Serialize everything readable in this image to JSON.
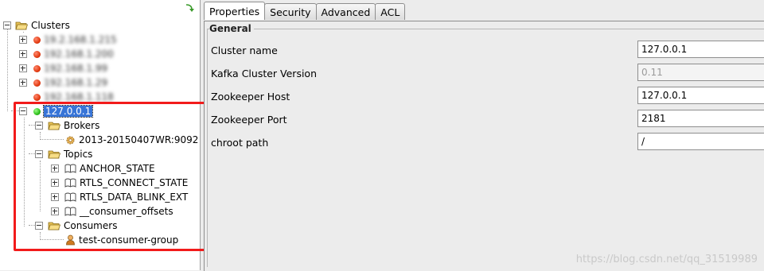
{
  "tree": {
    "root_label": "Clusters",
    "blurred_clusters": [
      "19.2.168.1.215",
      "192.168.1.200",
      "192.168.1.99",
      "192.168.1.29",
      "192.168.1.118"
    ],
    "selected_cluster": "127.0.0.1",
    "brokers": {
      "label": "Brokers",
      "items": [
        "2013-20150407WR:9092"
      ]
    },
    "topics": {
      "label": "Topics",
      "items": [
        "ANCHOR_STATE",
        "RTLS_CONNECT_STATE",
        "RTLS_DATA_BLINK_EXT",
        "__consumer_offsets"
      ]
    },
    "consumers": {
      "label": "Consumers",
      "items": [
        "test-consumer-group"
      ]
    }
  },
  "tabs": [
    "Properties",
    "Security",
    "Advanced",
    "ACL"
  ],
  "active_tab": "Properties",
  "group_title": "General",
  "properties": [
    {
      "label": "Cluster name",
      "value": "127.0.0.1",
      "disabled": false
    },
    {
      "label": "Kafka Cluster Version",
      "value": "0.11",
      "disabled": true
    },
    {
      "label": "Zookeeper Host",
      "value": "127.0.0.1",
      "disabled": false
    },
    {
      "label": "Zookeeper Port",
      "value": "2181",
      "disabled": false
    },
    {
      "label": "chroot path",
      "value": "/",
      "disabled": false
    }
  ],
  "watermark": "https://blog.csdn.net/qq_31519989",
  "colors": {
    "highlight": "#f21b1b",
    "selection": "#3875d7",
    "status_offline": "#e23a10",
    "status_online": "#2dbd1a"
  }
}
